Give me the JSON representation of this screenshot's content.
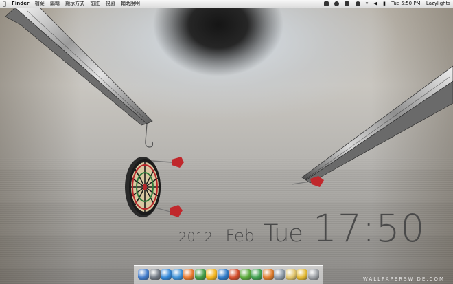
{
  "menubar": {
    "apple_glyph": "",
    "app_name": "Finder",
    "menus": [
      "檔案",
      "編輯",
      "顯示方式",
      "前往",
      "視窗",
      "輔助說明"
    ],
    "clock": "Tue 5:50 PM",
    "user": "Lazylights"
  },
  "desktop_clock": {
    "year": "2012",
    "month": "Feb",
    "day": "Tue",
    "time": "17:50"
  },
  "watermark": "WALLPAPERSWIDE.COM",
  "colors": {
    "menubar": "#e8e8e8",
    "clock_text": "#4a4a4a",
    "dart_flight": "#c0282c"
  },
  "dock": {
    "icons": [
      {
        "name": "finder-icon",
        "color": "#3f79c9"
      },
      {
        "name": "photo-icon",
        "color": "#6f7782"
      },
      {
        "name": "app-store-icon",
        "color": "#2f86d9"
      },
      {
        "name": "safari-icon",
        "color": "#3a8fd6"
      },
      {
        "name": "firefox-icon",
        "color": "#e8772a"
      },
      {
        "name": "chrome-icon",
        "color": "#3f9b43"
      },
      {
        "name": "sun-icon",
        "color": "#f4b41b"
      },
      {
        "name": "globe-icon",
        "color": "#2b78c8"
      },
      {
        "name": "maple-icon",
        "color": "#d34b2a"
      },
      {
        "name": "adium-icon",
        "color": "#5aaa3a"
      },
      {
        "name": "leaf-icon",
        "color": "#3ea04f"
      },
      {
        "name": "slideshow-icon",
        "color": "#e07b2a"
      },
      {
        "name": "preview-icon",
        "color": "#8c9aa8"
      },
      {
        "name": "folder-icon",
        "color": "#e0c46a"
      },
      {
        "name": "notes-icon",
        "color": "#e3b82f"
      },
      {
        "name": "trash-icon",
        "color": "#9a9ea3"
      }
    ]
  }
}
